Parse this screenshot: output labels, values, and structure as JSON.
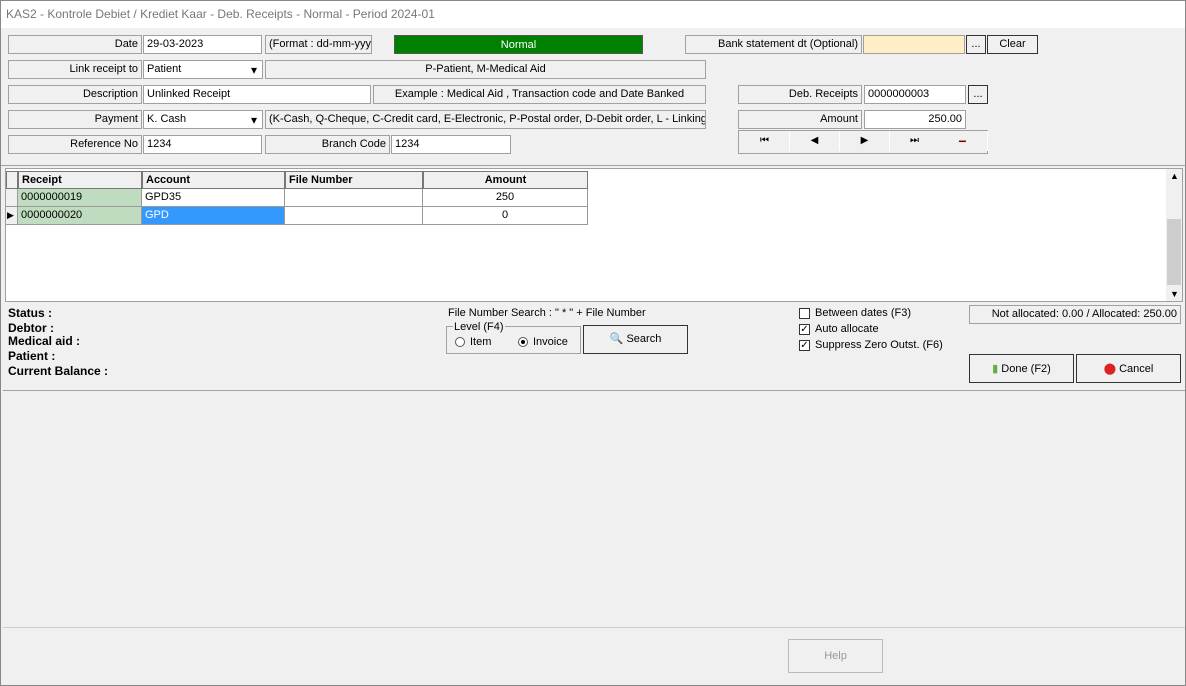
{
  "window": {
    "title": "KAS2 - Kontrole Debiet / Krediet Kaar - Deb. Receipts - Normal -  Period 2024-01"
  },
  "form": {
    "date_label": "Date",
    "date_value": "29-03-2023",
    "date_format": "(Format : dd-mm-yyyy)",
    "mode": "Normal",
    "mode_color": "#008000",
    "bank_label": "Bank statement dt (Optional)",
    "bank_value": "",
    "ellipsis": "...",
    "clear": "Clear",
    "link_label": "Link receipt to",
    "link_value": "Patient",
    "link_hint": "P-Patient, M-Medical Aid",
    "desc_label": "Description",
    "desc_value": "Unlinked Receipt",
    "desc_hint": "Example : Medical Aid  , Transaction code and Date Banked",
    "debrec_label": "Deb. Receipts",
    "debrec_value": "0000000003",
    "payment_label": "Payment",
    "payment_value": "K. Cash",
    "payment_hint": "(K-Cash, Q-Cheque,  C-Credit card, E-Electronic, P-Postal order, D-Debit order, L - Linking)",
    "amount_label": "Amount",
    "amount_value": "250.00",
    "ref_label": "Reference No",
    "ref_value": "1234",
    "branch_label": "Branch Code",
    "branch_value": "1234"
  },
  "nav": {
    "first": "⏮",
    "prev": "◀",
    "next": "▶",
    "last": "⏭",
    "delete": "−"
  },
  "table": {
    "columns": [
      "Receipt",
      "Account",
      "File Number",
      "Amount"
    ],
    "rows": [
      [
        "0000000019",
        "GPD35",
        "",
        "250"
      ],
      [
        "0000000020",
        "GPD",
        "",
        "0"
      ]
    ]
  },
  "info": {
    "status": "Status :",
    "debtor": "Debtor :",
    "medical": "Medical aid :",
    "patient": "Patient :",
    "balance": "Current Balance :"
  },
  "search": {
    "hint": "File Number Search : \" * \" + File Number",
    "level": "Level (F4)",
    "item": "Item",
    "invoice": "Invoice",
    "button": "Search"
  },
  "options": {
    "between": "Between dates (F3)",
    "auto": "Auto allocate",
    "suppress": "Suppress Zero Outst. (F6)"
  },
  "alloc": "Not allocated: 0.00 / Allocated: 250.00",
  "buttons": {
    "done": "Done (F2)",
    "cancel": "Cancel",
    "help": "Help"
  }
}
